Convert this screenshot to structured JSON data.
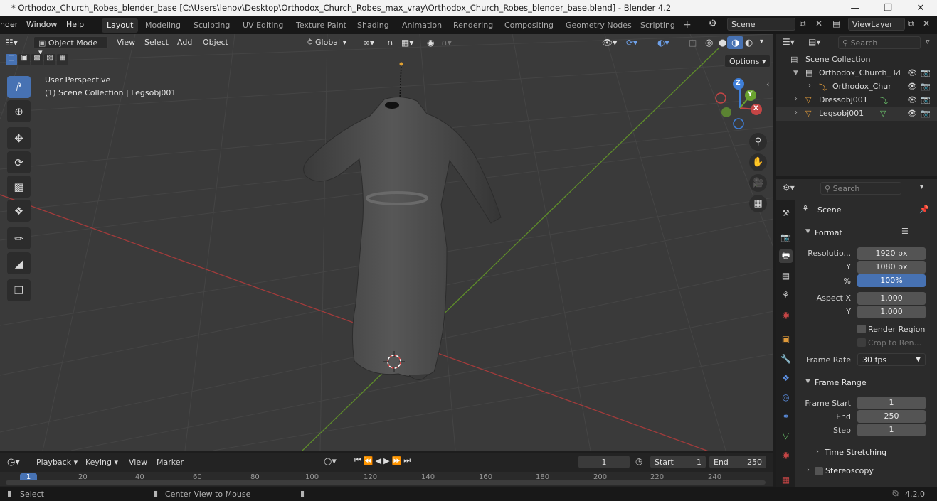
{
  "window": {
    "title": "* Orthodox_Church_Robes_blender_base [C:\\Users\\lenov\\Desktop\\Orthodox_Church_Robes_max_vray\\Orthodox_Church_Robes_blender_base.blend] - Blender 4.2",
    "minimize": "—",
    "maximize": "❐",
    "close": "✕"
  },
  "menubar": {
    "items": [
      "nder",
      "Window",
      "Help"
    ],
    "workspaces": [
      "Layout",
      "Modeling",
      "Sculpting",
      "UV Editing",
      "Texture Paint",
      "Shading",
      "Animation",
      "Rendering",
      "Compositing",
      "Geometry Nodes",
      "Scripting"
    ],
    "add_workspace": "+",
    "scene": "Scene",
    "view_layer": "ViewLayer"
  },
  "viewport_header": {
    "mode": "Object Mode",
    "menus": [
      "View",
      "Select",
      "Add",
      "Object"
    ],
    "orientation": "Global",
    "options": "Options"
  },
  "viewport": {
    "perspective": "User Perspective",
    "collection_info": "(1) Scene Collection | Legsobj001",
    "gizmo": {
      "x": "X",
      "y": "Y",
      "z": "Z"
    },
    "colors": {
      "x_axis": "#c44545",
      "y_axis": "#6aa32f",
      "z_axis": "#3f7fd9",
      "active": "#4772b3"
    }
  },
  "outliner": {
    "search_placeholder": "Search",
    "root": "Scene Collection",
    "items": [
      {
        "label": "Orthodox_Church_",
        "icon": "collection-icon"
      },
      {
        "label": "Orthodox_Chur",
        "icon": "armature-icon"
      },
      {
        "label": "Dressobj001",
        "icon": "mesh-icon"
      },
      {
        "label": "Legsobj001",
        "icon": "mesh-icon"
      }
    ]
  },
  "properties": {
    "search_placeholder": "Search",
    "context": "Scene",
    "format": {
      "title": "Format",
      "resolution_label": "Resolutio...",
      "res_x": "1920 px",
      "y_label": "Y",
      "res_y": "1080 px",
      "pct_label": "%",
      "res_pct": "100%",
      "aspect_x_label": "Aspect X",
      "aspect_x": "1.000",
      "aspect_y_label": "Y",
      "aspect_y": "1.000",
      "render_region": "Render Region",
      "crop": "Crop to Ren...",
      "frame_rate_label": "Frame Rate",
      "frame_rate": "30 fps"
    },
    "frame_range": {
      "title": "Frame Range",
      "start_label": "Frame Start",
      "start": "1",
      "end_label": "End",
      "end": "250",
      "step_label": "Step",
      "step": "1"
    },
    "time_stretching": "Time Stretching",
    "stereoscopy": "Stereoscopy"
  },
  "timeline": {
    "menus": [
      "Playback",
      "Keying",
      "View",
      "Marker"
    ],
    "current_frame": "1",
    "start_label": "Start",
    "start": "1",
    "end_label": "End",
    "end": "250",
    "ruler": [
      "1",
      "20",
      "40",
      "60",
      "80",
      "100",
      "120",
      "140",
      "160",
      "180",
      "200",
      "220",
      "240"
    ]
  },
  "statusbar": {
    "select": "Select",
    "center_view": "Center View to Mouse",
    "version": "4.2.0"
  }
}
